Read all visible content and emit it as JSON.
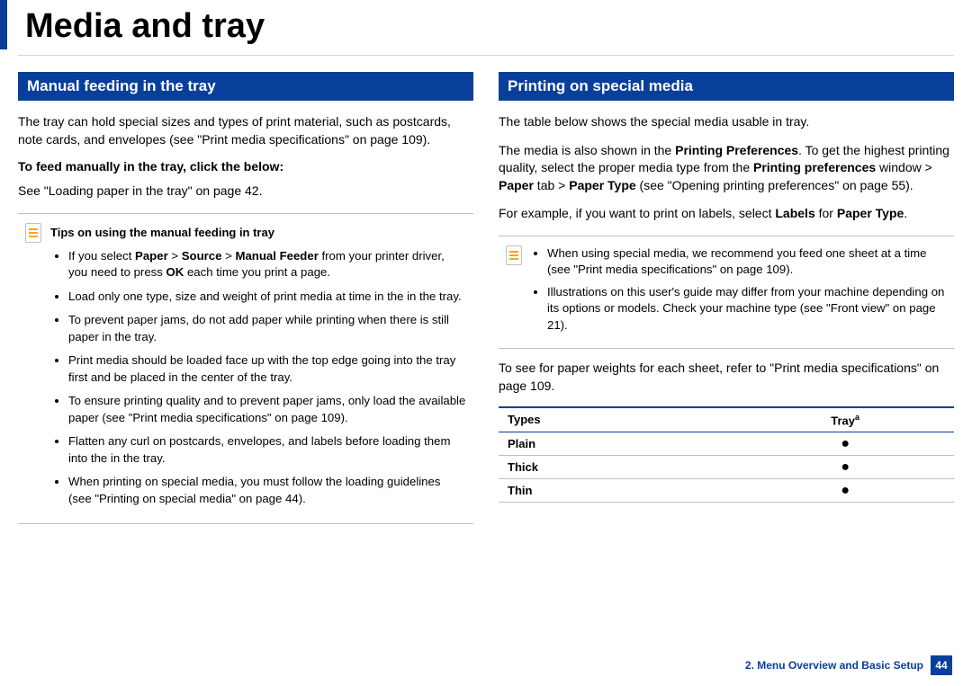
{
  "page_title": "Media and tray",
  "left": {
    "heading": "Manual feeding in the tray",
    "p1": "The tray can hold special sizes and types of print material, such as postcards, note cards, and envelopes (see \"Print media specifications\" on page 109).",
    "subhead": "To feed manually in the tray, click the below:",
    "p2": "See \"Loading paper in the tray\" on page 42.",
    "tip_title": "Tips on using the manual feeding in tray",
    "tips": {
      "t1a": "If you select ",
      "t1b": " from your printer driver, you need to press ",
      "t1c": " each time you print a page.",
      "t1_bold1": "Paper",
      "t1_bold2": "Source",
      "t1_bold3": "Manual Feeder",
      "t1_bold4": "OK",
      "t2": "Load only one type, size and weight of print media at time in the in the tray.",
      "t3": "To prevent paper jams, do not add paper while printing when there is still paper in the tray.",
      "t4": "Print media should be loaded face up with the top edge going into the tray first and be placed in the center of the tray.",
      "t5": "To ensure printing quality and to prevent paper jams, only load the available paper (see \"Print media specifications\" on page 109).",
      "t6": "Flatten any curl on postcards, envelopes, and labels before loading them into the in the tray.",
      "t7": "When printing on special media, you must follow the loading guidelines (see \"Printing on special media\" on page 44)."
    }
  },
  "right": {
    "heading": "Printing on special media",
    "p1": "The table below shows the special media usable in tray.",
    "p2a": "The media is also shown in the ",
    "p2b": ". To get the highest printing quality, select the proper media type from the ",
    "p2c": " window > ",
    "p2d": " tab > ",
    "p2e": " (see \"Opening printing preferences\" on page 55).",
    "p2_bold1": "Printing Preferences",
    "p2_bold2": "Printing preferences",
    "p2_bold3": "Paper",
    "p2_bold4": "Paper Type",
    "p3a": "For example, if you want to print on labels, select ",
    "p3b": " for ",
    "p3c": ".",
    "p3_bold1": "Labels",
    "p3_bold2": "Paper Type",
    "tips": {
      "t1": "When using special media, we recommend you feed one sheet at a time (see \"Print media specifications\" on page 109).",
      "t2": "Illustrations on this user's guide may differ from your machine depending on its options or models. Check your machine type (see \"Front view\" on page 21)."
    },
    "p4": "To see for paper weights for each sheet, refer to \"Print media specifications\" on page 109.",
    "table": {
      "h1": "Types",
      "h2": "Tray",
      "h2_sup": "a",
      "rows": [
        {
          "type": "Plain",
          "mark": "●"
        },
        {
          "type": "Thick",
          "mark": "●"
        },
        {
          "type": "Thin",
          "mark": "●"
        }
      ]
    }
  },
  "footer": {
    "chapter": "2.  Menu Overview and Basic Setup",
    "page": "44"
  }
}
